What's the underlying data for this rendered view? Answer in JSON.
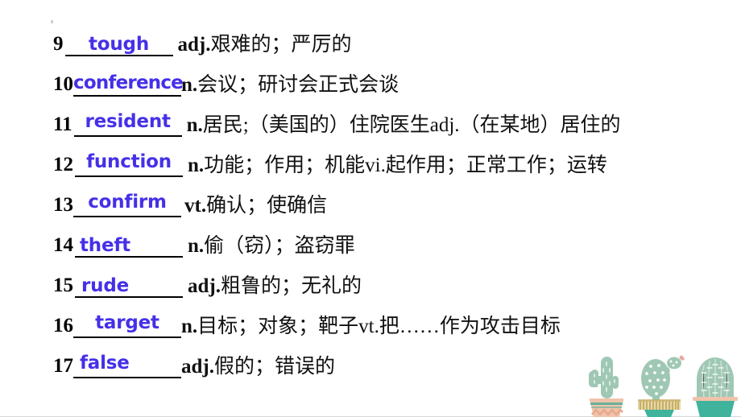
{
  "slide": {
    "title": "Vocabulary fill-in-the-blank list (items 9-17)",
    "answer_color": "#4530e8",
    "text_color": "#111111",
    "background": "#ffffff"
  },
  "vocabulary": [
    {
      "number": "9",
      "answer": "tough",
      "pos": "adj.",
      "meaning": "艰难的；严厉的"
    },
    {
      "number": "10",
      "answer": "conference",
      "pos": "n.",
      "meaning": "会议；研讨会正式会谈"
    },
    {
      "number": "11",
      "answer": "resident",
      "pos": "n.",
      "meaning": "居民;（美国的）住院医生adj.（在某地）居住的"
    },
    {
      "number": "12",
      "answer": "function",
      "pos": "n.",
      "meaning": "功能；作用；机能vi.起作用；正常工作；运转"
    },
    {
      "number": "13",
      "answer": "confirm",
      "pos": "vt.",
      "meaning": "确认；使确信"
    },
    {
      "number": "14",
      "answer": "theft",
      "pos": "n.",
      "meaning": "偷（窃）；盗窃罪"
    },
    {
      "number": "15",
      "answer": "rude",
      "pos": "adj.",
      "meaning": "粗鲁的；无礼的"
    },
    {
      "number": "16",
      "answer": "target",
      "pos": "n.",
      "meaning": "目标；对象；靶子vt.把……作为攻击目标"
    },
    {
      "number": "17",
      "answer": "false",
      "pos": "adj.",
      "meaning": "假的；错误的"
    }
  ],
  "decoration": {
    "cactus_green": "#9fc8b4",
    "cactus_green_dark": "#4fae99",
    "pot_peach": "#f0c3ab",
    "pot_gold": "#d9c48a",
    "pot_teal": "#3fb39b",
    "flower_pink": "#e8a9a0",
    "items": [
      {
        "name": "saguaro-cactus",
        "pot": "chevron-pot"
      },
      {
        "name": "paddle-cactus",
        "pot": "striped-pot"
      },
      {
        "name": "barrel-cactus",
        "pot": "teal-pot"
      }
    ]
  }
}
